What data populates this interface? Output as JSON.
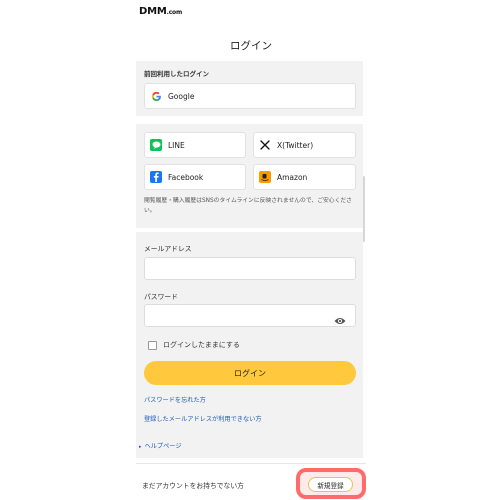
{
  "header": {
    "logo_main": "DMM",
    "logo_sub": ".com"
  },
  "page": {
    "title": "ログイン"
  },
  "last_login": {
    "label": "前回利用したログイン",
    "google_label": "Google"
  },
  "sns": {
    "line_label": "LINE",
    "x_label": "X(Twitter)",
    "facebook_label": "Facebook",
    "amazon_label": "Amazon",
    "note": "閲覧履歴・購入履歴はSNSのタイムラインに反映されませんので、ご安心ください。"
  },
  "form": {
    "email_label": "メールアドレス",
    "email_value": "",
    "password_label": "パスワード",
    "password_value": "",
    "remember_label": "ログインしたままにする",
    "login_label": "ログイン",
    "forgot_link": "パスワードを忘れた方",
    "cant_use_link": "登録したメールアドレスが利用できない方"
  },
  "help": {
    "label": "ヘルプページ"
  },
  "footer": {
    "no_account_text": "まだアカウントをお持ちでない方",
    "signup_label": "新規登録"
  },
  "colors": {
    "accent_yellow": "#ffc83d",
    "link_blue": "#1a56b4",
    "highlight_red": "#ff6b6b",
    "line_green": "#06c755",
    "facebook_blue": "#1877f2",
    "amazon_orange": "#ff9900"
  }
}
